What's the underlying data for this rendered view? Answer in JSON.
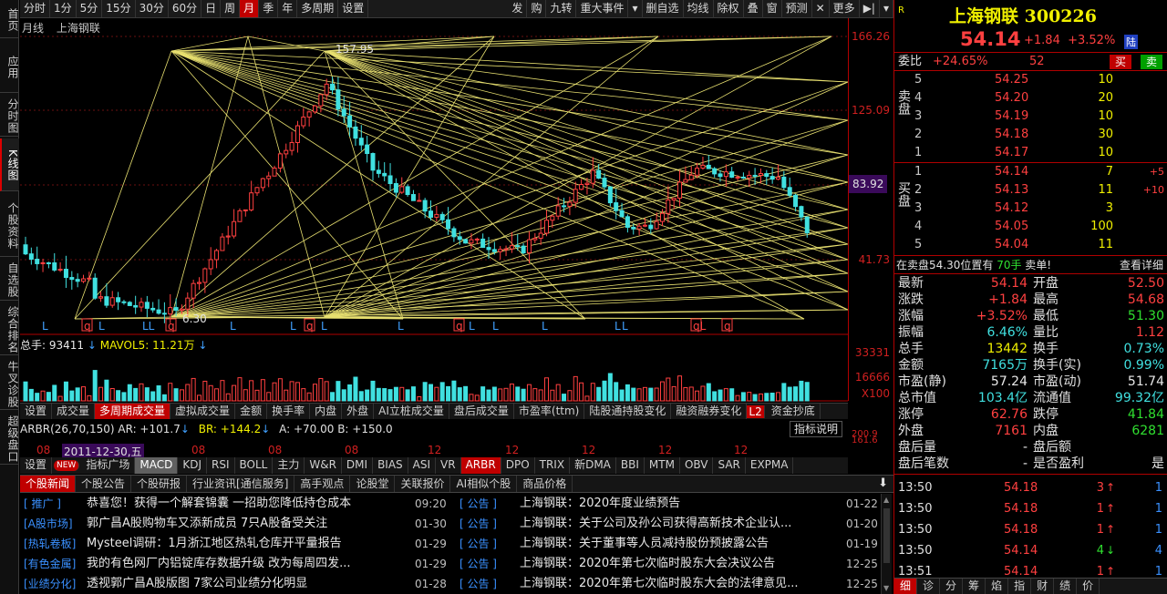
{
  "sidebar": [
    "首页",
    "应用",
    "分时图",
    "K线图",
    "个股资料",
    "自选股",
    "综合排名",
    "牛叉诊股",
    "超级盘口"
  ],
  "toolbar": {
    "left": [
      "分时",
      "1分",
      "5分",
      "15分",
      "30分",
      "60分",
      "日",
      "周",
      "月",
      "季",
      "年",
      "多周期",
      "设置"
    ],
    "active": "月",
    "right": [
      "发",
      "购",
      "九转",
      "重大事件",
      "▾",
      "删自选",
      "均线",
      "除权",
      "叠",
      "窗",
      "预测",
      "✕",
      "更多",
      "▶|",
      "▾"
    ]
  },
  "chart": {
    "period": "月线",
    "stock": "上海钢联",
    "high_label": "157.95",
    "low_label": "6.30",
    "price_ticks": [
      "166.26",
      "125.09",
      "83.92",
      "41.73"
    ],
    "highlight_price": "83.92",
    "markers": [
      "L",
      "q",
      "L",
      "LL",
      "q",
      "L",
      "L",
      "q",
      "L",
      "L",
      "q",
      "L",
      "L",
      "L",
      "L",
      "L",
      "qL",
      "q",
      "L"
    ],
    "cycle_lines": "yellow"
  },
  "volume": {
    "label": "总手: 93411",
    "mavol": "MAVOL5: 11.21万",
    "ticks": [
      "33331",
      "16666",
      "X100"
    ]
  },
  "tabs1": [
    "设置",
    "成交量",
    "多周期成交量",
    "虚拟成交量",
    "金额",
    "换手率",
    "内盘",
    "外盘",
    "AI立桩成交量",
    "盘后成交量",
    "市盈率(ttm)",
    "陆股通持股变化",
    "融资融券变化",
    "资金抄底"
  ],
  "tabs1_active": "多周期成交量",
  "tabs1_badge": "L2",
  "indicator": {
    "name": "ARBR(26,70,150)",
    "ar": "AR: +101.7",
    "br": "BR: +144.2",
    "a": "A: +70.00",
    "b": "B: +150.0",
    "button": "指标说明",
    "right_ticks": [
      "200.9",
      "161.6"
    ]
  },
  "xaxis": {
    "labels": [
      "08",
      "12",
      "08",
      "08",
      "08",
      "12",
      "12",
      "12",
      "12",
      "12"
    ],
    "highlight": "2011-12-30,五"
  },
  "tabs2": [
    "设置",
    "指标广场",
    "MACD",
    "KDJ",
    "RSI",
    "BOLL",
    "主力",
    "W&R",
    "DMI",
    "BIAS",
    "ASI",
    "VR",
    "ARBR",
    "DPO",
    "TRIX",
    "新DMA",
    "BBI",
    "MTM",
    "OBV",
    "SAR",
    "EXPMA"
  ],
  "tabs2_active": "MACD",
  "tabs2_red": "ARBR",
  "tabs2_new": "NEW",
  "newstabs": [
    "个股新闻",
    "个股公告",
    "个股研报",
    "行业资讯[通信服务]",
    "高手观点",
    "论股堂",
    "关联报价",
    "AI相似个股",
    "商品价格"
  ],
  "news": [
    {
      "cat": "[ 推广 ]",
      "title": "恭喜您！获得一个解套锦囊 一招助您降低持仓成本",
      "date": "09:20",
      "cat2": "[ 公告 ]",
      "title2": "上海钢联：2020年度业绩预告",
      "date2": "01-22"
    },
    {
      "cat": "[A股市场]",
      "title": "郭广昌A股购物车又添新成员 7只A股备受关注",
      "date": "01-30",
      "cat2": "[ 公告 ]",
      "title2": "上海钢联：关于公司及孙公司获得高新技术企业认...",
      "date2": "01-20"
    },
    {
      "cat": "[热轧卷板]",
      "title": "Mysteel调研：1月浙江地区热轧仓库开平量报告",
      "date": "01-29",
      "cat2": "[ 公告 ]",
      "title2": "上海钢联：关于董事等人员减持股份预披露公告",
      "date2": "01-19"
    },
    {
      "cat": "[有色金属]",
      "title": "我的有色网厂内铝锭库存数据升级 改为每周四发...",
      "date": "01-29",
      "cat2": "[ 公告 ]",
      "title2": "上海钢联：2020年第七次临时股东大会决议公告",
      "date2": "12-25"
    },
    {
      "cat": "[业绩分化]",
      "title": "透视郭广昌A股版图 7家公司业绩分化明显",
      "date": "01-28",
      "cat2": "[ 公告 ]",
      "title2": "上海钢联：2020年第七次临时股东大会的法律意见...",
      "date2": "12-25"
    }
  ],
  "right": {
    "mark": "R",
    "name": "上海钢联",
    "code": "300226",
    "price": "54.14",
    "change": "+1.84",
    "pct": "+3.52%",
    "tag": "陆",
    "weibi_label": "委比",
    "weibi": "+24.65%",
    "weicha": "52",
    "buy_btn": "买",
    "sell_btn": "卖",
    "sell_label": "卖盘",
    "buy_label": "买盘",
    "asks": [
      {
        "n": "5",
        "p": "54.25",
        "v": "10",
        "x": ""
      },
      {
        "n": "4",
        "p": "54.20",
        "v": "20",
        "x": ""
      },
      {
        "n": "3",
        "p": "54.19",
        "v": "10",
        "x": ""
      },
      {
        "n": "2",
        "p": "54.18",
        "v": "30",
        "x": ""
      },
      {
        "n": "1",
        "p": "54.17",
        "v": "10",
        "x": ""
      }
    ],
    "bids": [
      {
        "n": "1",
        "p": "54.14",
        "v": "7",
        "x": "+5"
      },
      {
        "n": "2",
        "p": "54.13",
        "v": "11",
        "x": "+10"
      },
      {
        "n": "3",
        "p": "54.12",
        "v": "3",
        "x": ""
      },
      {
        "n": "4",
        "p": "54.05",
        "v": "100",
        "x": ""
      },
      {
        "n": "5",
        "p": "54.04",
        "v": "11",
        "x": ""
      }
    ],
    "notice": "在卖盘54.30位置有",
    "notice_qty": "70手",
    "notice_end": "卖单!",
    "detail": "查看详细",
    "quotes": [
      {
        "l": "最新",
        "v": "54.14",
        "vc": "red",
        "l2": "开盘",
        "v2": "52.50",
        "v2c": "red"
      },
      {
        "l": "涨跌",
        "v": "+1.84",
        "vc": "red",
        "l2": "最高",
        "v2": "54.68",
        "v2c": "red"
      },
      {
        "l": "涨幅",
        "v": "+3.52%",
        "vc": "red",
        "l2": "最低",
        "v2": "51.30",
        "v2c": "green"
      },
      {
        "l": "振幅",
        "v": "6.46%",
        "vc": "cyan",
        "l2": "量比",
        "v2": "1.12",
        "v2c": "red"
      },
      {
        "l": "总手",
        "v": "13442",
        "vc": "yel",
        "l2": "换手",
        "v2": "0.73%",
        "v2c": "cyan"
      },
      {
        "l": "金额",
        "v": "7165万",
        "vc": "cyan",
        "l2": "换手(实)",
        "v2": "0.99%",
        "v2c": "cyan"
      },
      {
        "l": "市盈(静)",
        "v": "57.24",
        "vc": "white",
        "l2": "市盈(动)",
        "v2": "51.74",
        "v2c": "white"
      },
      {
        "l": "总市值",
        "v": "103.4亿",
        "vc": "cyan",
        "l2": "流通值",
        "v2": "99.32亿",
        "v2c": "cyan"
      },
      {
        "l": "涨停",
        "v": "62.76",
        "vc": "red",
        "l2": "跌停",
        "v2": "41.84",
        "v2c": "green"
      },
      {
        "l": "外盘",
        "v": "7161",
        "vc": "red",
        "l2": "内盘",
        "v2": "6281",
        "v2c": "green"
      },
      {
        "l": "盘后量",
        "v": "-",
        "vc": "white",
        "l2": "盘后额",
        "v2": "",
        "v2c": "white"
      },
      {
        "l": "盘后笔数",
        "v": "-",
        "vc": "white",
        "l2": "是否盈利",
        "v2": "是",
        "v2c": "white"
      }
    ],
    "ticks": [
      {
        "t": "13:50",
        "p": "54.18",
        "v": "3",
        "arr": "↑",
        "n": "1",
        "c": "red"
      },
      {
        "t": "13:50",
        "p": "54.18",
        "v": "1",
        "arr": "↑",
        "n": "1",
        "c": "red"
      },
      {
        "t": "13:50",
        "p": "54.18",
        "v": "1",
        "arr": "↑",
        "n": "1",
        "c": "red"
      },
      {
        "t": "13:50",
        "p": "54.14",
        "v": "4",
        "arr": "↓",
        "n": "4",
        "c": "green"
      },
      {
        "t": "13:51",
        "p": "54.14",
        "v": "1",
        "arr": "↑",
        "n": "1",
        "c": "red"
      }
    ],
    "tabs": [
      "细",
      "诊",
      "分",
      "筹",
      "焰",
      "指",
      "财",
      "绩",
      "价"
    ],
    "tab_active": "细"
  }
}
